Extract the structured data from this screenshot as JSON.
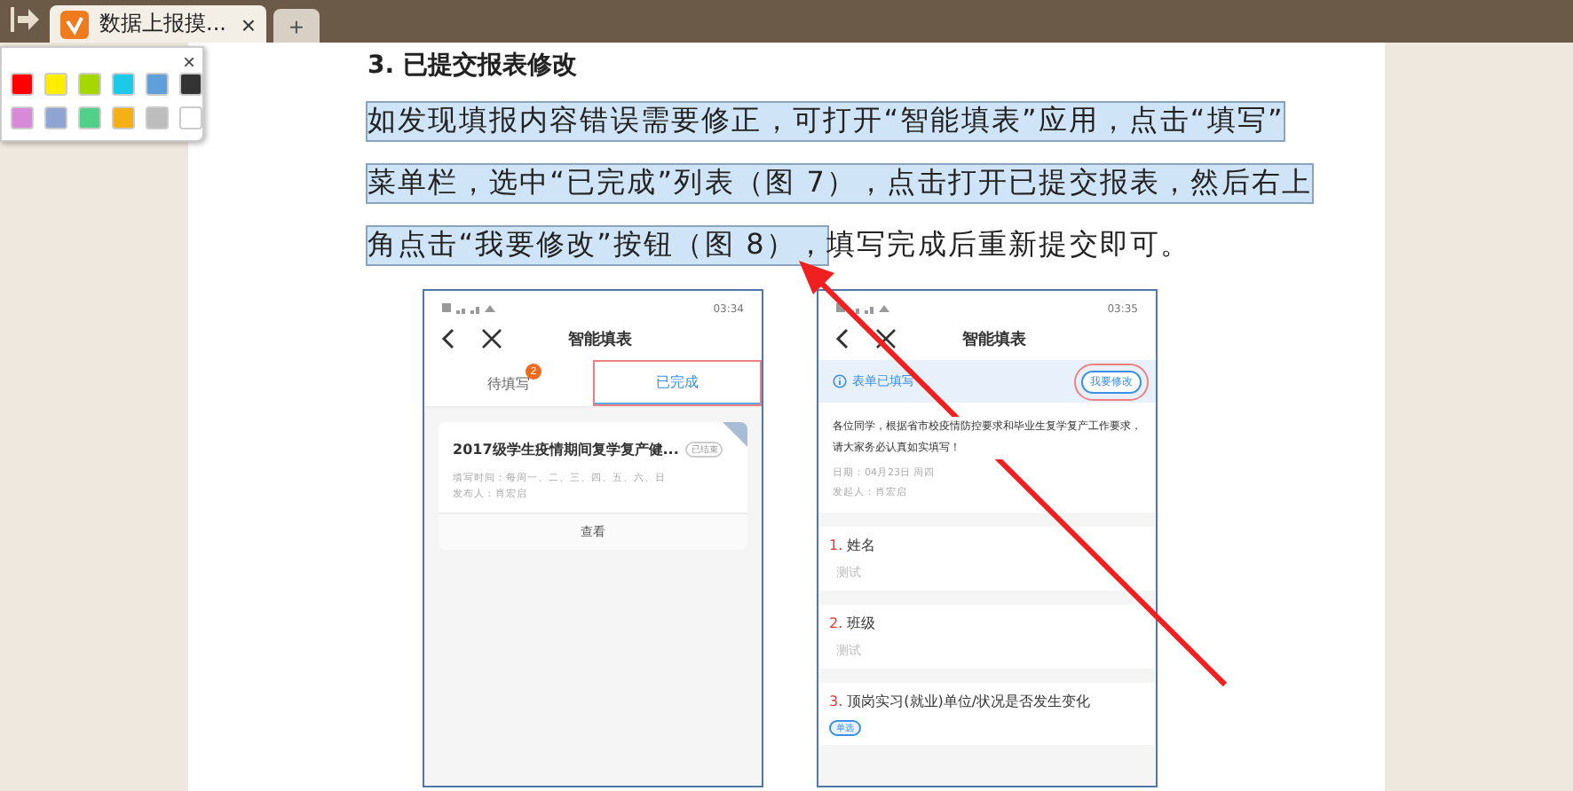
{
  "tabs": [
    {
      "title": "数据上报摸...",
      "close": "×",
      "selected": true
    }
  ],
  "new_tab": "+",
  "palette": {
    "close": "×",
    "colors": [
      {
        "color": "#ff0000"
      },
      {
        "color": "#ffee00"
      },
      {
        "color": "#a6d800"
      },
      {
        "color": "#1ec8e8"
      },
      {
        "color": "#5fa0d8"
      },
      {
        "color": "#333333"
      },
      {
        "color": "#d88ad8"
      },
      {
        "color": "#8fa4d0"
      },
      {
        "color": "#50d088"
      },
      {
        "color": "#f5b015"
      },
      {
        "color": "#bdbdbd"
      },
      {
        "color": "#ffffff"
      }
    ]
  },
  "document": {
    "heading": "3. 已提交报表修改",
    "lines": [
      {
        "segments": [
          {
            "text": "如发现填报内容错误需要修正，可打开“智能填表”应用，点击“填写”",
            "highlighted": true
          }
        ]
      },
      {
        "segments": [
          {
            "text": "菜单栏，选中“已完成”列表（图 7），点击打开已提交报表，然后右上",
            "highlighted": true
          }
        ]
      },
      {
        "segments": [
          {
            "text": "角点击“我要修改”按钮（图 8），",
            "highlighted": true
          },
          {
            "text": "填写完成后重新提交即可。",
            "highlighted": false
          }
        ]
      }
    ],
    "figure_7": {
      "time": "03:34",
      "title": "智能填表",
      "tabs": [
        {
          "label": "待填写",
          "badge": "2",
          "selected": false
        },
        {
          "label": "已完成",
          "selected": true
        }
      ],
      "card": {
        "title": "2017级学生疫情期间复学复产健...",
        "tag": "已结束",
        "fill_time": "填写时间：每周一、二、三、四、五、六、日",
        "publisher": "发布人：肖宏启",
        "action": "查看"
      }
    },
    "figure_8": {
      "time": "03:35",
      "title": "智能填表",
      "status": "表单已填写",
      "edit_button": "我要修改",
      "notice": "各位同学，根据省市校疫情防控要求和毕业生复学复产工作要求，请大家务必认真如实填写！",
      "date": "日期：04月23日 周四",
      "initiator": "发起人：肖宏启",
      "questions": [
        {
          "label": "1. 姓名",
          "value": "测试"
        },
        {
          "label": "2. 班级",
          "value": "测试"
        },
        {
          "label": "3. 顶岗实习(就业)单位/状况是否发生变化",
          "tag": "单选"
        }
      ]
    }
  }
}
